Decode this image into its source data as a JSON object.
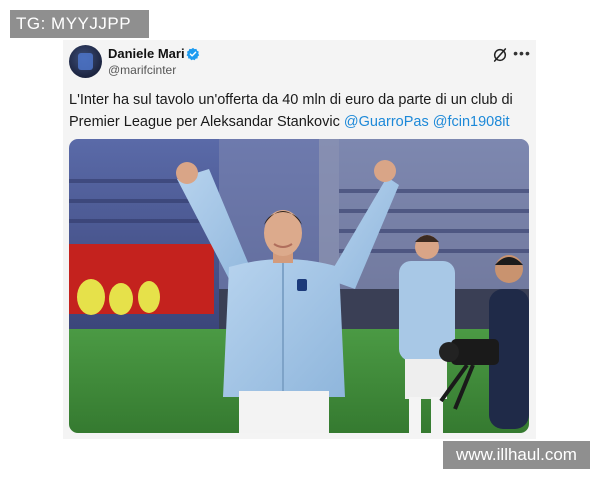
{
  "watermarks": {
    "top_left": "TG: MYYJJPP",
    "bottom_right": "www.illhaul.com"
  },
  "tweet": {
    "author_name": "Daniele Mari",
    "author_handle": "@marifcinter",
    "verified": true,
    "text_before": "L'Inter ha sul tavolo un'offerta da 40 mln di euro da parte di un club di Premier League per Aleksandar Stankovic ",
    "mention_1": "@GuarroPas",
    "mention_2": "@fcin1908it",
    "icons": {
      "verified": "verified-badge-icon",
      "grok": "grok-icon",
      "more": "more-options-icon"
    },
    "colors": {
      "verified": "#1d9bf0",
      "mention": "#1d89d8",
      "pitch": "#3f8a3a"
    },
    "photo_alt": "player-celebrating-photo"
  }
}
